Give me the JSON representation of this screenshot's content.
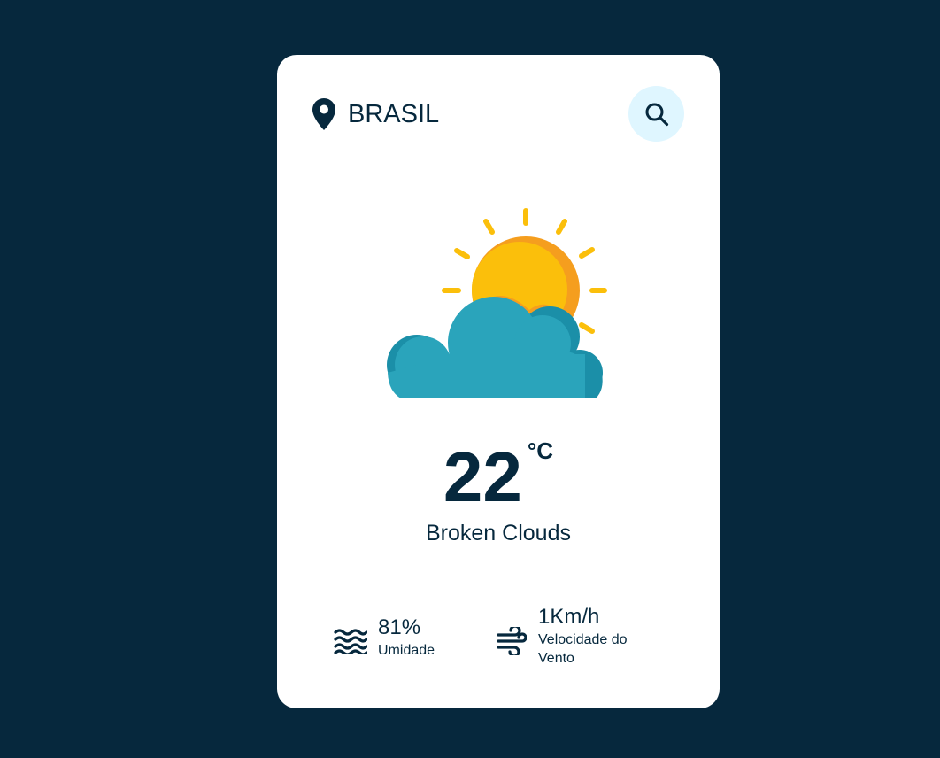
{
  "location": {
    "name": "BRASIL",
    "icon": "map-pin-icon"
  },
  "search": {
    "icon": "search-icon",
    "background": "#DFF6FF"
  },
  "weather": {
    "temperature": "22",
    "unit": "°C",
    "description": "Broken Clouds",
    "icon": "partly-cloudy-icon"
  },
  "stats": {
    "humidity": {
      "value": "81%",
      "label": "Umidade",
      "icon": "water-waves-icon"
    },
    "wind": {
      "value": "1Km/h",
      "label": "Velocidade do Vento",
      "icon": "wind-icon"
    }
  },
  "colors": {
    "background": "#06283D",
    "card": "#FFFFFF",
    "text": "#06283D",
    "sun": "#FBBF0B",
    "sun_shade": "#F59E1E",
    "cloud": "#2AA4BB",
    "cloud_shade": "#1B8FA8"
  }
}
